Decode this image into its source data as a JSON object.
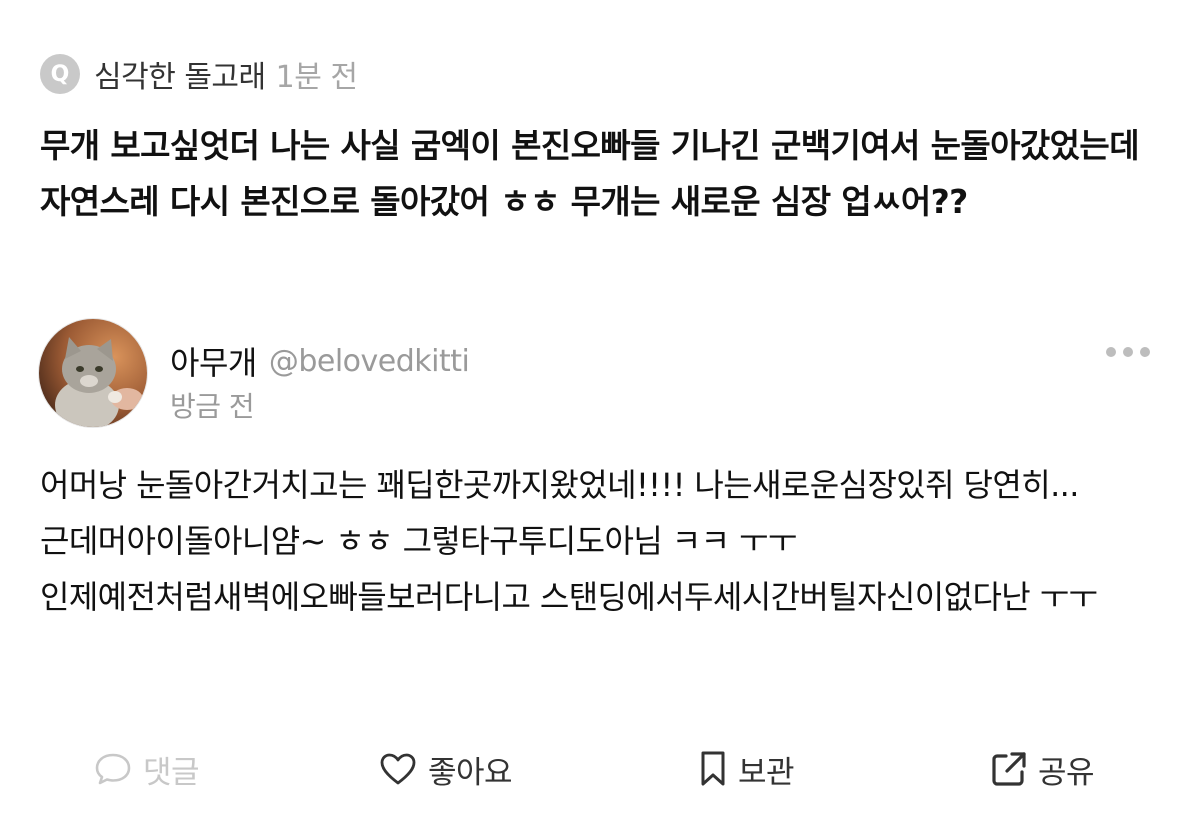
{
  "question": {
    "badge": "Q",
    "author": "심각한 돌고래",
    "time": "1분 전",
    "text": "무개 보고싶엇더 나는 사실 굼엑이 본진오빠들 기나긴 군백기여서 눈돌아갔었는데 자연스레 다시 본진으로 돌아갔어 ㅎㅎ 무개는 새로운 심장 업ㅆ어??"
  },
  "answer": {
    "name": "아무개",
    "handle": "@belovedkitti",
    "time": "방금 전",
    "avatar_icon": "cat-photo-avatar",
    "text": "어머낭 눈돌아간거치고는 꽤딥한곳까지왔었네!!!! 나는새로운심장있쥐 당연히... 근데머아이돌아니얌~ ㅎㅎ 그렇타구투디도아님 ㅋㅋ ㅜㅜ 인제예전처럼새벽에오빠들보러다니고 스탠딩에서두세시간버틸자신이없다난 ㅜㅜ"
  },
  "actions": {
    "comment": {
      "label": "댓글",
      "icon": "speech-bubble-icon"
    },
    "like": {
      "label": "좋아요",
      "icon": "heart-icon"
    },
    "save": {
      "label": "보관",
      "icon": "bookmark-icon"
    },
    "share": {
      "label": "공유",
      "icon": "share-icon"
    }
  },
  "colors": {
    "muted": "#a6a6a6",
    "disabled": "#c8c8c8",
    "text": "#111111",
    "badge": "#c9c9c9"
  }
}
